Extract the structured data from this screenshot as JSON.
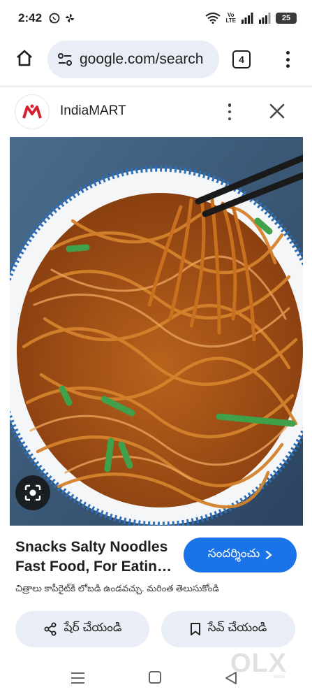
{
  "status_bar": {
    "time": "2:42",
    "volte_label": "Vo\nLTE",
    "battery_level": "25"
  },
  "browser": {
    "url": "google.com/search",
    "tab_count": "4"
  },
  "source": {
    "name": "IndiaMART"
  },
  "result": {
    "title": "Snacks Salty Noodles Fast Food, For Eatin…",
    "visit_label": "సందర్శించు",
    "copyright_note": "చిత్రాలు కాపీరైట్‌కి లోబడి ఉండవచ్చు. మరింత తెలుసుకోండి",
    "share_label": "షేర్ చేయండి",
    "save_label": "సేవ్ చేయండి"
  },
  "watermark": {
    "text": "OLX",
    "sub": "INDIA"
  },
  "icons": {
    "home": "home-icon",
    "site_settings": "tune-icon",
    "lens": "google-lens-icon",
    "share": "share-icon",
    "bookmark": "bookmark-icon",
    "close": "close-icon"
  },
  "colors": {
    "accent": "#1a73e8",
    "omnibox_bg": "#e9edf6",
    "chip_bg": "#eaeef6",
    "brand_red": "#d3202f"
  }
}
